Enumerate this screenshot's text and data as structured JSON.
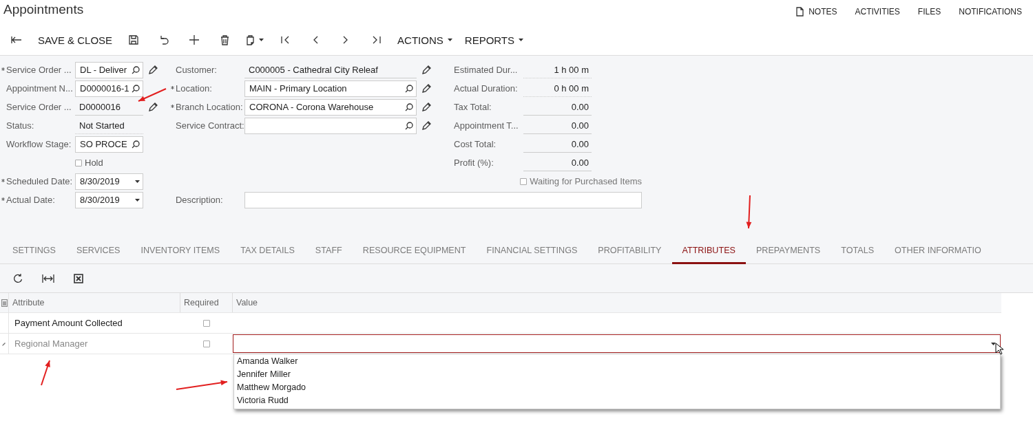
{
  "header": {
    "title": "Appointments",
    "links": [
      {
        "label": "NOTES",
        "kind": "icon_link"
      },
      {
        "label": "ACTIVITIES",
        "kind": "link"
      },
      {
        "label": "FILES",
        "kind": "link"
      },
      {
        "label": "NOTIFICATIONS",
        "kind": "link"
      }
    ]
  },
  "toolbar": {
    "save_close": "SAVE & CLOSE",
    "menus": [
      "ACTIONS",
      "REPORTS"
    ]
  },
  "form": {
    "columns": [
      [
        {
          "label": "Service Order ...",
          "value": "DL - Deliver",
          "kind": "lookup_edit",
          "required": true
        },
        {
          "label": "Appointment N...",
          "value": "D0000016-1",
          "kind": "lookup",
          "required": false
        },
        {
          "label": "Service Order ...",
          "value": "D0000016",
          "kind": "readonly_edit",
          "required": false
        },
        {
          "label": "Status:",
          "value": "Not Started",
          "kind": "readonly_dotted",
          "required": false
        },
        {
          "label": "Workflow Stage:",
          "value": "SO PROCE",
          "kind": "lookup",
          "required": false
        },
        {
          "label": "Hold",
          "kind": "checkbox",
          "checked": false,
          "disabled": false,
          "required": false
        },
        {
          "label": "Scheduled Date:",
          "value": "8/30/2019",
          "kind": "date",
          "required": true
        },
        {
          "label": "Actual Date:",
          "value": "8/30/2019",
          "kind": "date",
          "required": true
        }
      ],
      [
        {
          "label": "Customer:",
          "value": "C000005 - Cathedral City Releaf",
          "kind": "readonly_edit",
          "required": false
        },
        {
          "label": "Location:",
          "value": "MAIN - Primary Location",
          "kind": "lookup_edit",
          "required": true
        },
        {
          "label": "Branch Location:",
          "value": "CORONA - Corona Warehouse",
          "kind": "lookup_edit",
          "required": true
        },
        {
          "label": "Service Contract:",
          "kind": "lookup_edit",
          "required": false
        }
      ],
      [
        {
          "label": "Estimated Dur...",
          "value": "1 h 00 m",
          "kind": "readonly_dotted",
          "required": false
        },
        {
          "label": "Actual Duration:",
          "value": "0 h 00 m",
          "kind": "readonly_dotted",
          "required": false
        },
        {
          "label": "Tax Total:",
          "value": "0.00",
          "kind": "readonly",
          "required": false
        },
        {
          "label": "Appointment T...",
          "value": "0.00",
          "kind": "readonly",
          "required": false
        },
        {
          "label": "Cost Total:",
          "value": "0.00",
          "kind": "readonly",
          "required": false
        },
        {
          "label": "Profit (%):",
          "value": "0.00",
          "kind": "readonly",
          "required": false
        },
        {
          "label": "Waiting for Purchased Items",
          "kind": "checkbox",
          "checked": false,
          "disabled": true,
          "required": false
        }
      ]
    ],
    "description": {
      "label": "Description:"
    }
  },
  "tabs": [
    {
      "label": "SETTINGS",
      "selected": false
    },
    {
      "label": "SERVICES",
      "selected": false
    },
    {
      "label": "INVENTORY ITEMS",
      "selected": false
    },
    {
      "label": "TAX DETAILS",
      "selected": false
    },
    {
      "label": "STAFF",
      "selected": false
    },
    {
      "label": "RESOURCE EQUIPMENT",
      "selected": false
    },
    {
      "label": "FINANCIAL SETTINGS",
      "selected": false
    },
    {
      "label": "PROFITABILITY",
      "selected": false
    },
    {
      "label": "ATTRIBUTES",
      "selected": true
    },
    {
      "label": "PREPAYMENTS",
      "selected": false
    },
    {
      "label": "TOTALS",
      "selected": false
    },
    {
      "label": "OTHER INFORMATIO",
      "selected": false
    }
  ],
  "table": {
    "columns": [
      "Attribute",
      "Required",
      "Value"
    ],
    "rows": [
      {
        "attribute": "Payment Amount Collected",
        "required": false,
        "selected": false
      },
      {
        "attribute": "Regional Manager",
        "required": false,
        "selected": true,
        "dropdown": {
          "open": true,
          "options": [
            "Amanda Walker",
            "Jennifer Miller",
            "Matthew Morgado",
            "Victoria Rudd"
          ]
        }
      }
    ]
  }
}
